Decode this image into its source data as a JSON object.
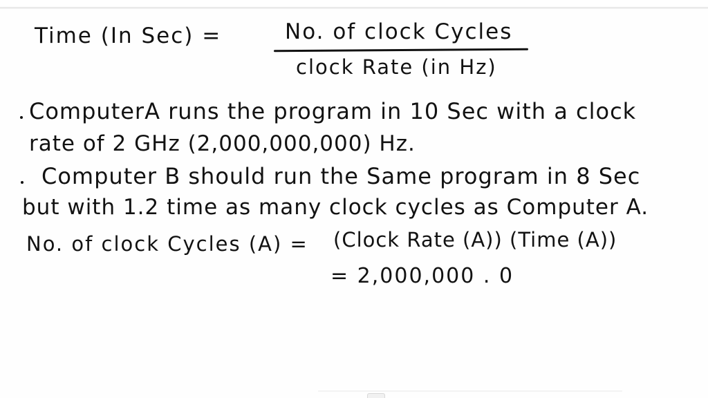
{
  "equation": {
    "lhs": "Time (In Sec) =",
    "numerator": "No. of clock Cycles",
    "denominator": "clock Rate (in Hz)"
  },
  "notes": [
    {
      "bullet": true,
      "lines": [
        "ComputerA runs the program in 10 Sec with a clock",
        "rate of 2 GHz (2,000,000,000) Hz."
      ]
    },
    {
      "bullet": true,
      "lines": [
        "Computer B should run the Same program in 8 Sec",
        "but with 1.2 time as many clock cycles as Computer A."
      ]
    }
  ],
  "calculation": {
    "lhs": "No. of clock Cycles (A) =",
    "rhs": "(Clock Rate (A)) (Time (A))",
    "result": "= 2,000,000 . 0"
  }
}
